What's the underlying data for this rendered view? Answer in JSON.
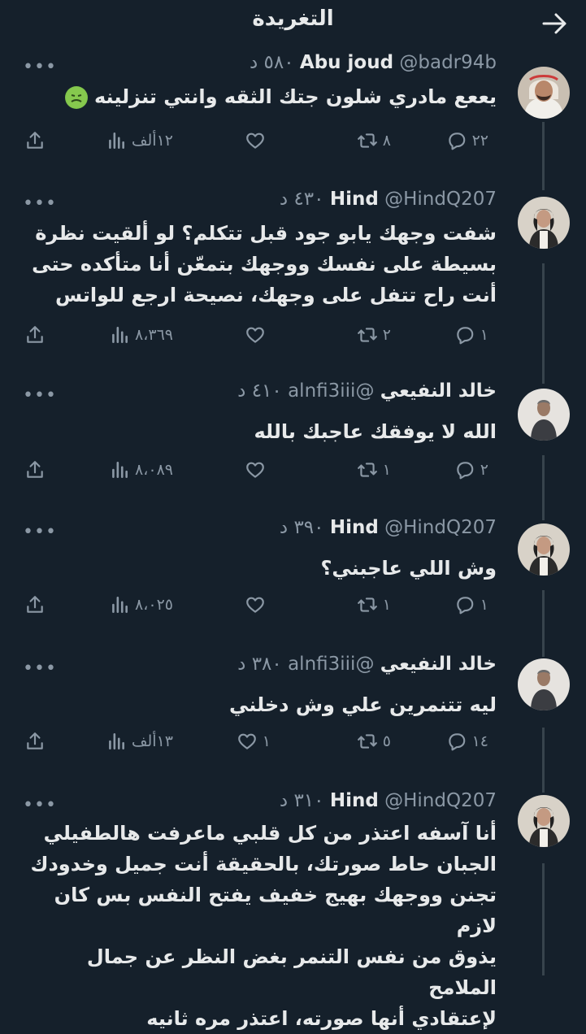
{
  "header": {
    "title": "التغريدة"
  },
  "tweets": [
    {
      "name": "Abu joud",
      "handle": "@badr94b",
      "time": "٥٨٠ د",
      "text": "يععع مادري شلون جتك الثقه وانتي تنزلينه",
      "emoji": "nauseated-face",
      "replies": "٢٢",
      "retweets": "٨",
      "likes": "",
      "views": "١٢ألف"
    },
    {
      "name": "Hind",
      "handle": "@HindQ207",
      "time": "٤٣٠ د",
      "lines": [
        "شفت وجهك يابو جود قبل تتكلم؟ لو ألقيت نظرة",
        "بسيطة على نفسك ووجهك بتمعّن أنا متأكده حتى",
        "أنت راح تتفل على وجهك، نصيحة ارجع للواتس"
      ],
      "replies": "١",
      "retweets": "٢",
      "likes": "",
      "views": "٨،٣٦٩"
    },
    {
      "name": "خالد النفيعي",
      "handle": "@alnfi3iii",
      "time": "٤١٠ د",
      "text": "الله لا يوفقك عاجبك بالله",
      "replies": "٢",
      "retweets": "١",
      "likes": "",
      "views": "٨،٠٨٩"
    },
    {
      "name": "Hind",
      "handle": "@HindQ207",
      "time": "٣٩٠ د",
      "text": "وش اللي عاجبني؟",
      "replies": "١",
      "retweets": "١",
      "likes": "",
      "views": "٨،٠٢٥"
    },
    {
      "name": "خالد النفيعي",
      "handle": "@alnfi3iii",
      "time": "٣٨٠ د",
      "text": "ليه تتنمرين علي وش دخلني",
      "replies": "١٤",
      "retweets": "٥",
      "likes": "١",
      "views": "١٣ألف"
    },
    {
      "name": "Hind",
      "handle": "@HindQ207",
      "time": "٣١٠ د",
      "lines": [
        "أنا آسفه اعتذر من كل قلبي ماعرفت هالطفيلي",
        "الجبان حاط صورتك، بالحقيقة أنت جميل وخدودك",
        "تجنن ووجهك بهيج خفيف يفتح النفس بس كان لازم",
        "يذوق من نفس التنمر بغض النظر عن جمال الملامح",
        "لإعتقادي أنها صورته، اعتذر مره ثانيه"
      ]
    }
  ],
  "colors": {
    "background": "#15202b",
    "text": "#e7e9ea",
    "muted": "#8b98a5",
    "thread_line": "#38444d"
  }
}
